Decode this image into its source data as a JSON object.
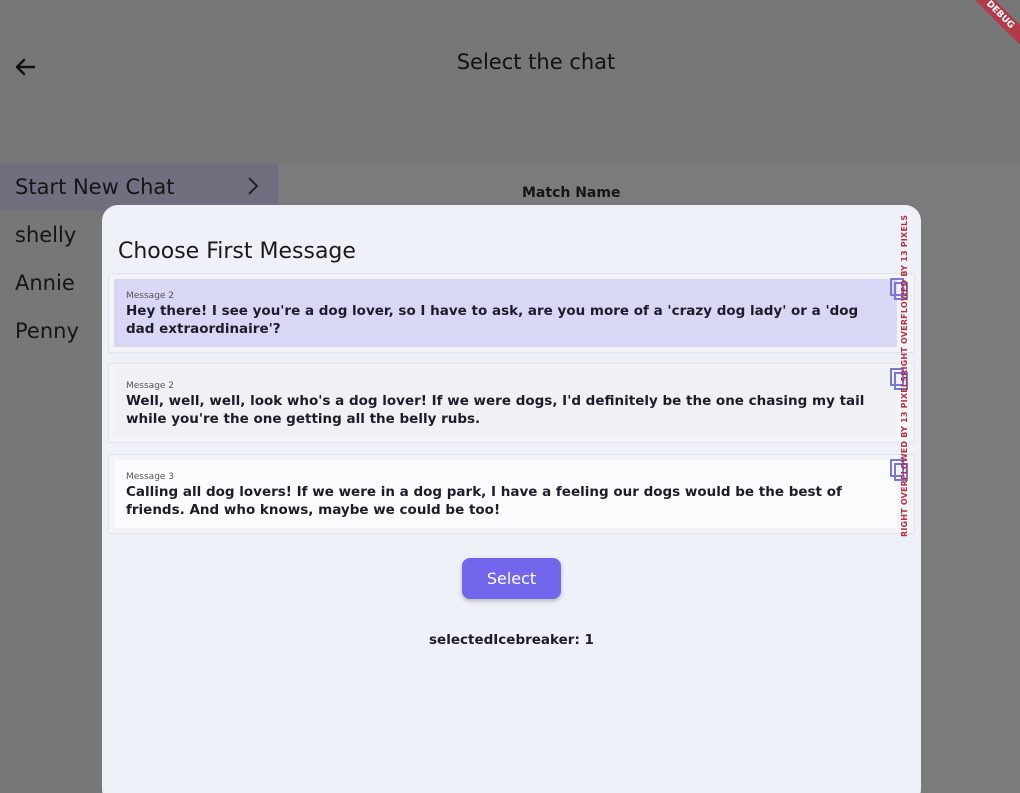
{
  "appbar": {
    "title": "Select the chat"
  },
  "debug_banner": "DEBUG",
  "sidebar": {
    "items": [
      {
        "label": "Start New Chat"
      },
      {
        "label": "shelly"
      },
      {
        "label": "Annie"
      },
      {
        "label": "Penny"
      }
    ]
  },
  "content": {
    "match_name_label": "Match Name"
  },
  "modal": {
    "title": "Choose First Message",
    "messages": [
      {
        "label": "Message 2",
        "text": "Hey there! I see you're a dog lover, so I have to ask, are you more of a 'crazy dog lady' or a 'dog dad extraordinaire'?"
      },
      {
        "label": "Message 2",
        "text": "Well, well, well, look who's a dog lover! If we were dogs, I'd definitely be the one chasing my tail while you're the one getting all the belly rubs."
      },
      {
        "label": "Message 3",
        "text": "Calling all dog lovers! If we were in a dog park, I have a feeling our dogs would be the best of friends. And who knows, maybe we could be too!"
      }
    ],
    "overflow_warning": "RIGHT OVERFLOWED BY 13 PIXELSRIGHT OVERFLOWED BY 13 PIXELS RIGHT OVERFLOWED BY 13 PIXELS",
    "select_label": "Select",
    "status": "selectedIcebreaker: 1"
  },
  "colors": {
    "accent": "#7166ec",
    "selected_card": "#d8d7f6",
    "overflow_red": "#b2313f"
  }
}
